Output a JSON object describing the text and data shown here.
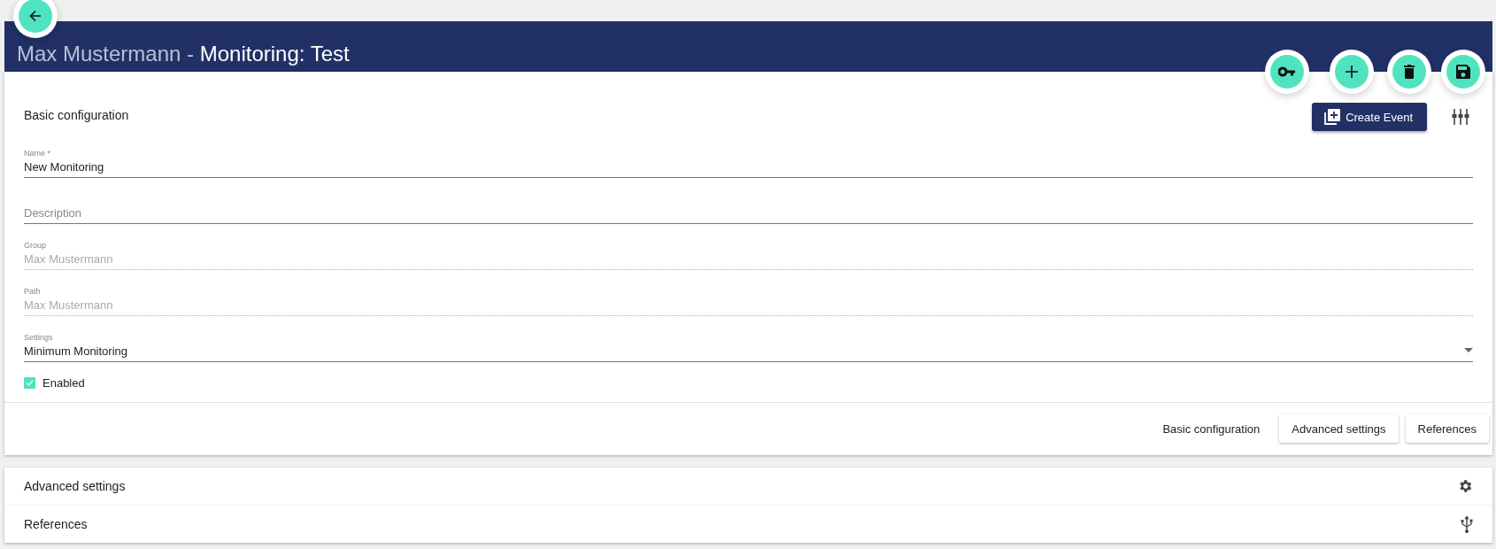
{
  "header": {
    "owner": "Max Mustermann",
    "separator": " - ",
    "title": "Monitoring: Test"
  },
  "section": {
    "title": "Basic configuration",
    "create_button": "Create Event"
  },
  "fields": [
    {
      "kind": "text",
      "label": "Name *",
      "value": "New Monitoring",
      "disabled": false
    },
    {
      "kind": "text",
      "placeholder": "Description",
      "disabled": false
    },
    {
      "kind": "text",
      "label": "Group",
      "value": "Max Mustermann",
      "disabled": true
    },
    {
      "kind": "text",
      "label": "Path",
      "value": "Max Mustermann",
      "disabled": true
    },
    {
      "kind": "select",
      "label": "Settings",
      "value": "Minimum Monitoring",
      "disabled": false
    }
  ],
  "enabled": {
    "label": "Enabled",
    "checked": true
  },
  "section_tabs": [
    {
      "label": "Basic configuration",
      "selected": true
    },
    {
      "label": "Advanced settings",
      "selected": false
    },
    {
      "label": "References",
      "selected": false
    }
  ],
  "panels": [
    {
      "title": "Advanced settings",
      "kind": "gear"
    },
    {
      "title": "References",
      "kind": "usb"
    }
  ]
}
